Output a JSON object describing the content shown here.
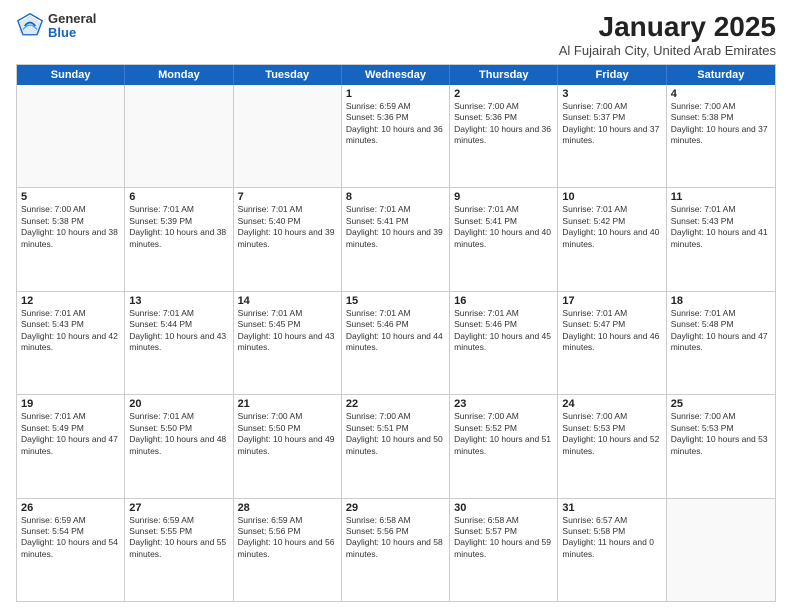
{
  "logo": {
    "general": "General",
    "blue": "Blue"
  },
  "title": {
    "month": "January 2025",
    "location": "Al Fujairah City, United Arab Emirates"
  },
  "header_days": [
    "Sunday",
    "Monday",
    "Tuesday",
    "Wednesday",
    "Thursday",
    "Friday",
    "Saturday"
  ],
  "weeks": [
    [
      {
        "day": "",
        "sunrise": "",
        "sunset": "",
        "daylight": "",
        "empty": true
      },
      {
        "day": "",
        "sunrise": "",
        "sunset": "",
        "daylight": "",
        "empty": true
      },
      {
        "day": "",
        "sunrise": "",
        "sunset": "",
        "daylight": "",
        "empty": true
      },
      {
        "day": "1",
        "sunrise": "Sunrise: 6:59 AM",
        "sunset": "Sunset: 5:36 PM",
        "daylight": "Daylight: 10 hours and 36 minutes.",
        "empty": false
      },
      {
        "day": "2",
        "sunrise": "Sunrise: 7:00 AM",
        "sunset": "Sunset: 5:36 PM",
        "daylight": "Daylight: 10 hours and 36 minutes.",
        "empty": false
      },
      {
        "day": "3",
        "sunrise": "Sunrise: 7:00 AM",
        "sunset": "Sunset: 5:37 PM",
        "daylight": "Daylight: 10 hours and 37 minutes.",
        "empty": false
      },
      {
        "day": "4",
        "sunrise": "Sunrise: 7:00 AM",
        "sunset": "Sunset: 5:38 PM",
        "daylight": "Daylight: 10 hours and 37 minutes.",
        "empty": false
      }
    ],
    [
      {
        "day": "5",
        "sunrise": "Sunrise: 7:00 AM",
        "sunset": "Sunset: 5:38 PM",
        "daylight": "Daylight: 10 hours and 38 minutes.",
        "empty": false
      },
      {
        "day": "6",
        "sunrise": "Sunrise: 7:01 AM",
        "sunset": "Sunset: 5:39 PM",
        "daylight": "Daylight: 10 hours and 38 minutes.",
        "empty": false
      },
      {
        "day": "7",
        "sunrise": "Sunrise: 7:01 AM",
        "sunset": "Sunset: 5:40 PM",
        "daylight": "Daylight: 10 hours and 39 minutes.",
        "empty": false
      },
      {
        "day": "8",
        "sunrise": "Sunrise: 7:01 AM",
        "sunset": "Sunset: 5:41 PM",
        "daylight": "Daylight: 10 hours and 39 minutes.",
        "empty": false
      },
      {
        "day": "9",
        "sunrise": "Sunrise: 7:01 AM",
        "sunset": "Sunset: 5:41 PM",
        "daylight": "Daylight: 10 hours and 40 minutes.",
        "empty": false
      },
      {
        "day": "10",
        "sunrise": "Sunrise: 7:01 AM",
        "sunset": "Sunset: 5:42 PM",
        "daylight": "Daylight: 10 hours and 40 minutes.",
        "empty": false
      },
      {
        "day": "11",
        "sunrise": "Sunrise: 7:01 AM",
        "sunset": "Sunset: 5:43 PM",
        "daylight": "Daylight: 10 hours and 41 minutes.",
        "empty": false
      }
    ],
    [
      {
        "day": "12",
        "sunrise": "Sunrise: 7:01 AM",
        "sunset": "Sunset: 5:43 PM",
        "daylight": "Daylight: 10 hours and 42 minutes.",
        "empty": false
      },
      {
        "day": "13",
        "sunrise": "Sunrise: 7:01 AM",
        "sunset": "Sunset: 5:44 PM",
        "daylight": "Daylight: 10 hours and 43 minutes.",
        "empty": false
      },
      {
        "day": "14",
        "sunrise": "Sunrise: 7:01 AM",
        "sunset": "Sunset: 5:45 PM",
        "daylight": "Daylight: 10 hours and 43 minutes.",
        "empty": false
      },
      {
        "day": "15",
        "sunrise": "Sunrise: 7:01 AM",
        "sunset": "Sunset: 5:46 PM",
        "daylight": "Daylight: 10 hours and 44 minutes.",
        "empty": false
      },
      {
        "day": "16",
        "sunrise": "Sunrise: 7:01 AM",
        "sunset": "Sunset: 5:46 PM",
        "daylight": "Daylight: 10 hours and 45 minutes.",
        "empty": false
      },
      {
        "day": "17",
        "sunrise": "Sunrise: 7:01 AM",
        "sunset": "Sunset: 5:47 PM",
        "daylight": "Daylight: 10 hours and 46 minutes.",
        "empty": false
      },
      {
        "day": "18",
        "sunrise": "Sunrise: 7:01 AM",
        "sunset": "Sunset: 5:48 PM",
        "daylight": "Daylight: 10 hours and 47 minutes.",
        "empty": false
      }
    ],
    [
      {
        "day": "19",
        "sunrise": "Sunrise: 7:01 AM",
        "sunset": "Sunset: 5:49 PM",
        "daylight": "Daylight: 10 hours and 47 minutes.",
        "empty": false
      },
      {
        "day": "20",
        "sunrise": "Sunrise: 7:01 AM",
        "sunset": "Sunset: 5:50 PM",
        "daylight": "Daylight: 10 hours and 48 minutes.",
        "empty": false
      },
      {
        "day": "21",
        "sunrise": "Sunrise: 7:00 AM",
        "sunset": "Sunset: 5:50 PM",
        "daylight": "Daylight: 10 hours and 49 minutes.",
        "empty": false
      },
      {
        "day": "22",
        "sunrise": "Sunrise: 7:00 AM",
        "sunset": "Sunset: 5:51 PM",
        "daylight": "Daylight: 10 hours and 50 minutes.",
        "empty": false
      },
      {
        "day": "23",
        "sunrise": "Sunrise: 7:00 AM",
        "sunset": "Sunset: 5:52 PM",
        "daylight": "Daylight: 10 hours and 51 minutes.",
        "empty": false
      },
      {
        "day": "24",
        "sunrise": "Sunrise: 7:00 AM",
        "sunset": "Sunset: 5:53 PM",
        "daylight": "Daylight: 10 hours and 52 minutes.",
        "empty": false
      },
      {
        "day": "25",
        "sunrise": "Sunrise: 7:00 AM",
        "sunset": "Sunset: 5:53 PM",
        "daylight": "Daylight: 10 hours and 53 minutes.",
        "empty": false
      }
    ],
    [
      {
        "day": "26",
        "sunrise": "Sunrise: 6:59 AM",
        "sunset": "Sunset: 5:54 PM",
        "daylight": "Daylight: 10 hours and 54 minutes.",
        "empty": false
      },
      {
        "day": "27",
        "sunrise": "Sunrise: 6:59 AM",
        "sunset": "Sunset: 5:55 PM",
        "daylight": "Daylight: 10 hours and 55 minutes.",
        "empty": false
      },
      {
        "day": "28",
        "sunrise": "Sunrise: 6:59 AM",
        "sunset": "Sunset: 5:56 PM",
        "daylight": "Daylight: 10 hours and 56 minutes.",
        "empty": false
      },
      {
        "day": "29",
        "sunrise": "Sunrise: 6:58 AM",
        "sunset": "Sunset: 5:56 PM",
        "daylight": "Daylight: 10 hours and 58 minutes.",
        "empty": false
      },
      {
        "day": "30",
        "sunrise": "Sunrise: 6:58 AM",
        "sunset": "Sunset: 5:57 PM",
        "daylight": "Daylight: 10 hours and 59 minutes.",
        "empty": false
      },
      {
        "day": "31",
        "sunrise": "Sunrise: 6:57 AM",
        "sunset": "Sunset: 5:58 PM",
        "daylight": "Daylight: 11 hours and 0 minutes.",
        "empty": false
      },
      {
        "day": "",
        "sunrise": "",
        "sunset": "",
        "daylight": "",
        "empty": true
      }
    ]
  ]
}
